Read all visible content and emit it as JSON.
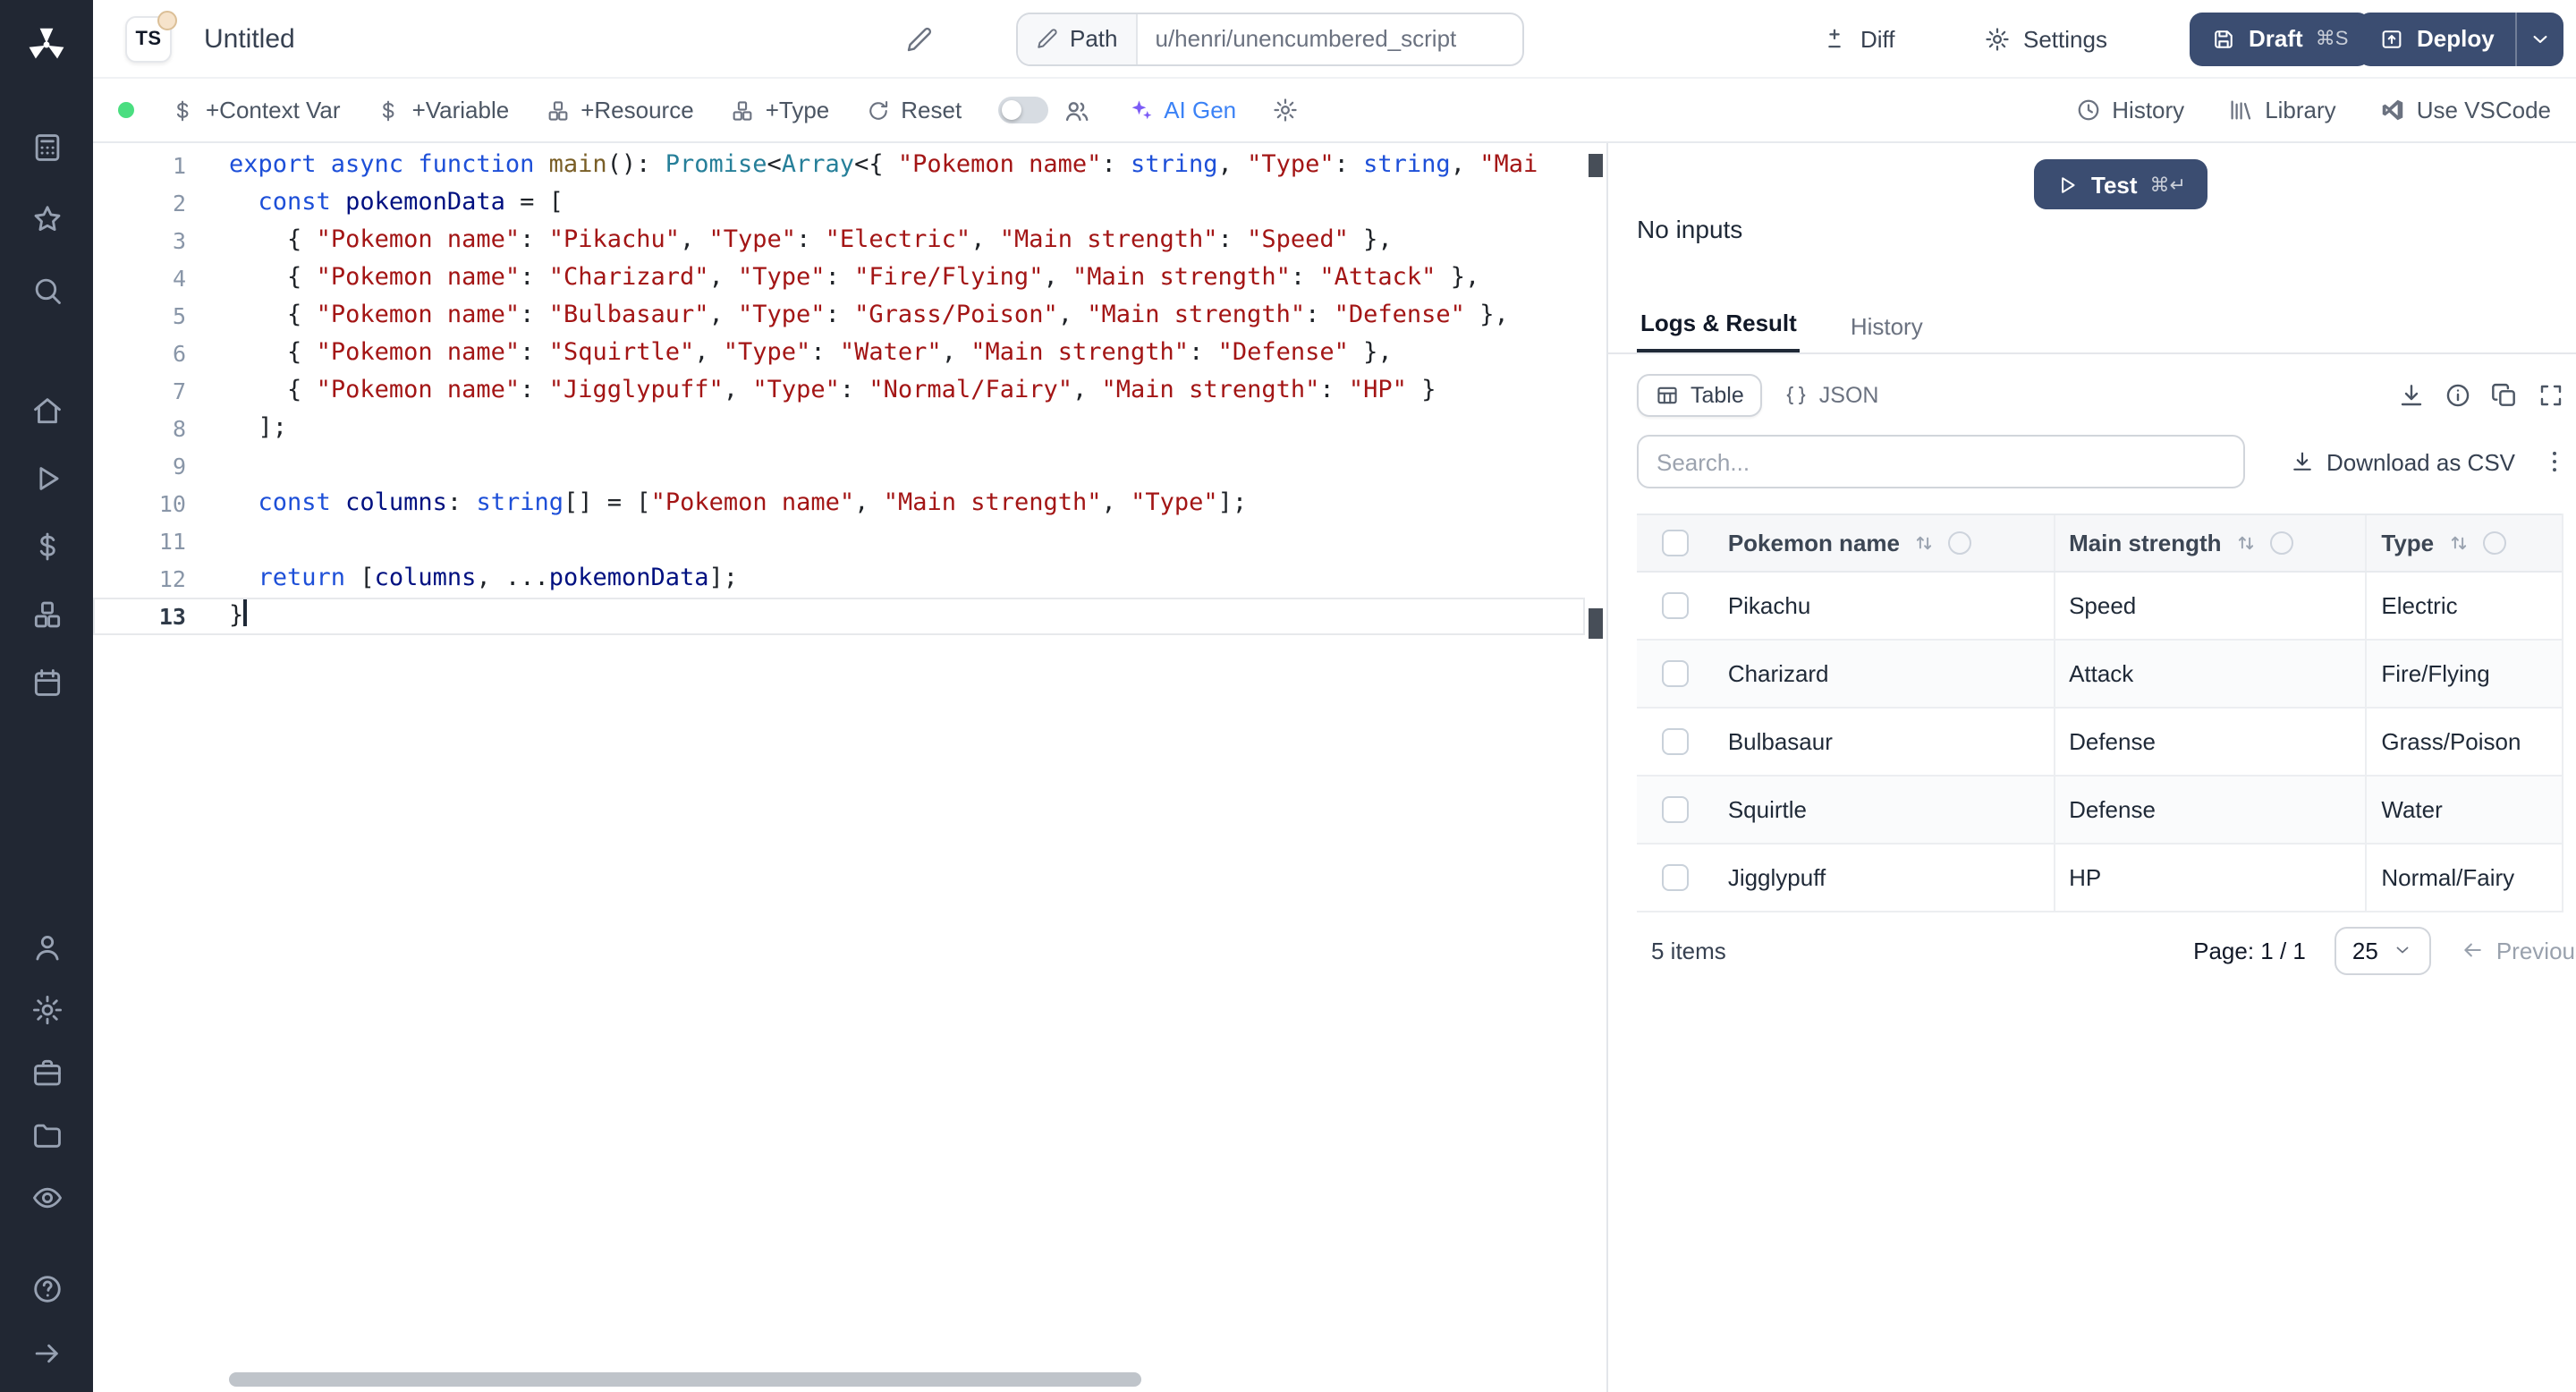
{
  "colors": {
    "dark_button": "#3b4d71",
    "accent_blue": "#3b82f6",
    "ai_icon_violet": "#7c5cf6",
    "status_green": "#4ade80",
    "keyword_blue": "#1d4fd8",
    "string_red": "#a31515",
    "sidebar_bg": "#212733"
  },
  "sidebar": {
    "groups": [
      [
        "grid",
        "star",
        "search"
      ],
      [
        "home",
        "play",
        "dollar",
        "blocks",
        "calendar"
      ],
      [
        "user",
        "gear",
        "briefcase",
        "folder",
        "eye"
      ]
    ],
    "footer_icons": [
      "help",
      "arrow-right"
    ]
  },
  "topbar": {
    "lang_badge": "TS",
    "title": "Untitled",
    "path_label": "Path",
    "path_value": "u/henri/unencumbered_script",
    "diff_label": "Diff",
    "settings_label": "Settings",
    "draft_label": "Draft",
    "draft_shortcut": "⌘S",
    "deploy_label": "Deploy"
  },
  "toolbar": {
    "context_var": "+Context Var",
    "variable": "+Variable",
    "resource": "+Resource",
    "type": "+Type",
    "reset": "Reset",
    "ai_gen": "AI Gen",
    "history": "History",
    "library": "Library",
    "vscode": "Use VSCode"
  },
  "editor": {
    "lines": [
      {
        "n": 1,
        "t": [
          [
            "k",
            "export async function "
          ],
          [
            "f",
            "main"
          ],
          [
            "p",
            "(): "
          ],
          [
            "y",
            "Promise"
          ],
          [
            "p",
            "<"
          ],
          [
            "y",
            "Array"
          ],
          [
            "p",
            "<{ "
          ],
          [
            "s",
            "\"Pokemon name\""
          ],
          [
            "p",
            ": "
          ],
          [
            "k",
            "string"
          ],
          [
            "p",
            ", "
          ],
          [
            "s",
            "\"Type\""
          ],
          [
            "p",
            ": "
          ],
          [
            "k",
            "string"
          ],
          [
            "p",
            ", "
          ],
          [
            "s",
            "\"Mai"
          ]
        ]
      },
      {
        "n": 2,
        "t": [
          [
            "p",
            "  "
          ],
          [
            "k",
            "const"
          ],
          [
            "p",
            " "
          ],
          [
            "v",
            "pokemonData"
          ],
          [
            "p",
            " = ["
          ]
        ]
      },
      {
        "n": 3,
        "t": [
          [
            "p",
            "    { "
          ],
          [
            "s",
            "\"Pokemon name\""
          ],
          [
            "p",
            ": "
          ],
          [
            "s",
            "\"Pikachu\""
          ],
          [
            "p",
            ", "
          ],
          [
            "s",
            "\"Type\""
          ],
          [
            "p",
            ": "
          ],
          [
            "s",
            "\"Electric\""
          ],
          [
            "p",
            ", "
          ],
          [
            "s",
            "\"Main strength\""
          ],
          [
            "p",
            ": "
          ],
          [
            "s",
            "\"Speed\""
          ],
          [
            "p",
            " },"
          ]
        ]
      },
      {
        "n": 4,
        "t": [
          [
            "p",
            "    { "
          ],
          [
            "s",
            "\"Pokemon name\""
          ],
          [
            "p",
            ": "
          ],
          [
            "s",
            "\"Charizard\""
          ],
          [
            "p",
            ", "
          ],
          [
            "s",
            "\"Type\""
          ],
          [
            "p",
            ": "
          ],
          [
            "s",
            "\"Fire/Flying\""
          ],
          [
            "p",
            ", "
          ],
          [
            "s",
            "\"Main strength\""
          ],
          [
            "p",
            ": "
          ],
          [
            "s",
            "\"Attack\""
          ],
          [
            "p",
            " },"
          ]
        ]
      },
      {
        "n": 5,
        "t": [
          [
            "p",
            "    { "
          ],
          [
            "s",
            "\"Pokemon name\""
          ],
          [
            "p",
            ": "
          ],
          [
            "s",
            "\"Bulbasaur\""
          ],
          [
            "p",
            ", "
          ],
          [
            "s",
            "\"Type\""
          ],
          [
            "p",
            ": "
          ],
          [
            "s",
            "\"Grass/Poison\""
          ],
          [
            "p",
            ", "
          ],
          [
            "s",
            "\"Main strength\""
          ],
          [
            "p",
            ": "
          ],
          [
            "s",
            "\"Defense\""
          ],
          [
            "p",
            " },"
          ]
        ]
      },
      {
        "n": 6,
        "t": [
          [
            "p",
            "    { "
          ],
          [
            "s",
            "\"Pokemon name\""
          ],
          [
            "p",
            ": "
          ],
          [
            "s",
            "\"Squirtle\""
          ],
          [
            "p",
            ", "
          ],
          [
            "s",
            "\"Type\""
          ],
          [
            "p",
            ": "
          ],
          [
            "s",
            "\"Water\""
          ],
          [
            "p",
            ", "
          ],
          [
            "s",
            "\"Main strength\""
          ],
          [
            "p",
            ": "
          ],
          [
            "s",
            "\"Defense\""
          ],
          [
            "p",
            " },"
          ]
        ]
      },
      {
        "n": 7,
        "t": [
          [
            "p",
            "    { "
          ],
          [
            "s",
            "\"Pokemon name\""
          ],
          [
            "p",
            ": "
          ],
          [
            "s",
            "\"Jigglypuff\""
          ],
          [
            "p",
            ", "
          ],
          [
            "s",
            "\"Type\""
          ],
          [
            "p",
            ": "
          ],
          [
            "s",
            "\"Normal/Fairy\""
          ],
          [
            "p",
            ", "
          ],
          [
            "s",
            "\"Main strength\""
          ],
          [
            "p",
            ": "
          ],
          [
            "s",
            "\"HP\""
          ],
          [
            "p",
            " }"
          ]
        ]
      },
      {
        "n": 8,
        "t": [
          [
            "p",
            "  ];"
          ]
        ]
      },
      {
        "n": 9,
        "t": []
      },
      {
        "n": 10,
        "t": [
          [
            "p",
            "  "
          ],
          [
            "k",
            "const"
          ],
          [
            "p",
            " "
          ],
          [
            "v",
            "columns"
          ],
          [
            "p",
            ": "
          ],
          [
            "k",
            "string"
          ],
          [
            "p",
            "[] = ["
          ],
          [
            "s",
            "\"Pokemon name\""
          ],
          [
            "p",
            ", "
          ],
          [
            "s",
            "\"Main strength\""
          ],
          [
            "p",
            ", "
          ],
          [
            "s",
            "\"Type\""
          ],
          [
            "p",
            "];"
          ]
        ]
      },
      {
        "n": 11,
        "t": []
      },
      {
        "n": 12,
        "t": [
          [
            "p",
            "  "
          ],
          [
            "k",
            "return"
          ],
          [
            "p",
            " ["
          ],
          [
            "v",
            "columns"
          ],
          [
            "p",
            ", ..."
          ],
          [
            "v",
            "pokemonData"
          ],
          [
            "p",
            "];"
          ]
        ]
      },
      {
        "n": 13,
        "t": [
          [
            "p",
            "}"
          ]
        ],
        "active": true,
        "cursor": true
      }
    ]
  },
  "results": {
    "test_button": {
      "label": "Test",
      "shortcut": "⌘↵"
    },
    "no_inputs": "No inputs",
    "tabs": [
      "Logs & Result",
      "History"
    ],
    "view_toggle": [
      "Table",
      "JSON"
    ],
    "search_placeholder": "Search...",
    "download_csv_label": "Download as CSV",
    "table": {
      "columns": [
        "Pokemon name",
        "Main strength",
        "Type"
      ],
      "rows": [
        [
          "Pikachu",
          "Speed",
          "Electric"
        ],
        [
          "Charizard",
          "Attack",
          "Fire/Flying"
        ],
        [
          "Bulbasaur",
          "Defense",
          "Grass/Poison"
        ],
        [
          "Squirtle",
          "Defense",
          "Water"
        ],
        [
          "Jigglypuff",
          "HP",
          "Normal/Fairy"
        ]
      ]
    },
    "footer": {
      "items_count": "5 items",
      "page": "Page: 1 / 1",
      "page_size": "25",
      "previous": "Previous"
    }
  }
}
